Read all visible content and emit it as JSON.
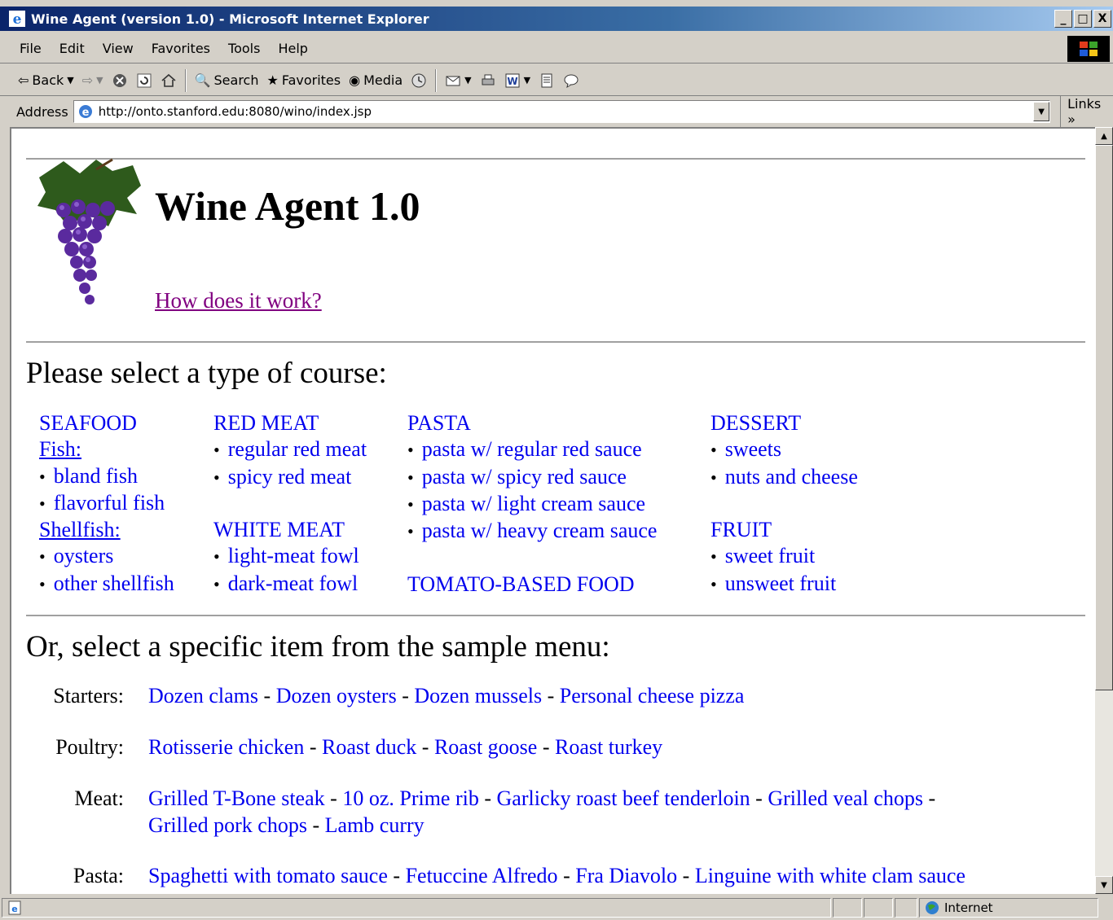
{
  "window": {
    "title": "Wine Agent (version 1.0) - Microsoft Internet Explorer",
    "controls": [
      "_",
      "□",
      "X"
    ]
  },
  "menubar": {
    "items": [
      "File",
      "Edit",
      "View",
      "Favorites",
      "Tools",
      "Help"
    ]
  },
  "toolbar": {
    "back_label": "Back",
    "search_label": "Search",
    "favorites_label": "Favorites",
    "media_label": "Media"
  },
  "address": {
    "label": "Address",
    "url": "http://onto.stanford.edu:8080/wino/index.jsp",
    "links_label": "Links",
    "links_chevron": "»"
  },
  "page": {
    "heading": "Wine Agent 1.0",
    "how_link": "How does it work?",
    "course_prompt": "Please select a type of course:",
    "menu_prompt": "Or, select a specific item from the sample menu:"
  },
  "courses": {
    "seafood": {
      "header": "SEAFOOD",
      "fish_label": "Fish:",
      "fish_items": [
        "bland fish",
        "flavorful fish"
      ],
      "shellfish_label": "Shellfish:",
      "shellfish_items": [
        "oysters",
        "other shellfish"
      ]
    },
    "red_meat": {
      "header": "RED MEAT",
      "items": [
        "regular red meat",
        "spicy red meat"
      ]
    },
    "white_meat": {
      "header": "WHITE MEAT",
      "items": [
        "light-meat fowl",
        "dark-meat fowl"
      ]
    },
    "pasta": {
      "header": "PASTA",
      "items": [
        "pasta w/ regular red sauce",
        "pasta w/ spicy red sauce",
        "pasta w/ light cream sauce",
        "pasta w/ heavy cream sauce"
      ]
    },
    "tomato": {
      "header": "TOMATO-BASED FOOD"
    },
    "dessert": {
      "header": "DESSERT",
      "items": [
        "sweets",
        "nuts and cheese"
      ]
    },
    "fruit": {
      "header": "FRUIT",
      "items": [
        "sweet fruit",
        "unsweet fruit"
      ]
    }
  },
  "sample_menu": {
    "separator": "-",
    "starters": {
      "label": "Starters:",
      "items": [
        "Dozen clams",
        "Dozen oysters",
        "Dozen mussels",
        "Personal cheese pizza"
      ]
    },
    "poultry": {
      "label": "Poultry:",
      "items": [
        "Rotisserie chicken",
        "Roast duck",
        "Roast goose",
        "Roast turkey"
      ]
    },
    "meat": {
      "label": "Meat:",
      "items": [
        "Grilled T-Bone steak",
        "10 oz. Prime rib",
        "Garlicky roast beef tenderloin",
        "Grilled veal chops",
        "Grilled pork chops",
        "Lamb curry"
      ]
    },
    "pasta": {
      "label": "Pasta:",
      "items": [
        "Spaghetti with tomato sauce",
        "Fetuccine Alfredo",
        "Fra Diavolo",
        "Linguine with white clam sauce"
      ]
    }
  },
  "statusbar": {
    "zone_label": "Internet"
  },
  "colors": {
    "link": "#0000ee",
    "visited_link": "#800080",
    "titlebar_start": "#0a246a",
    "titlebar_end": "#a6caf0",
    "chrome": "#d4d0c8"
  }
}
